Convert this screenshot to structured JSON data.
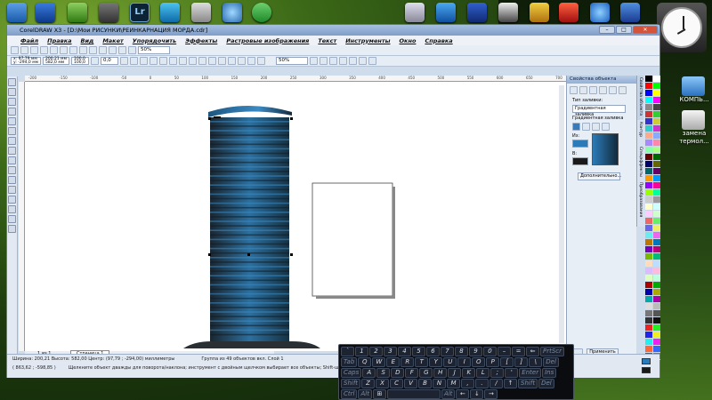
{
  "taskbar_icons": [
    "folder-icon",
    "tools-icon",
    "paint-icon",
    "lightroom-icon",
    "kaspersky-icon",
    "disk-icon",
    "globe-icon",
    "security-icon",
    "printer-icon",
    "sync-icon",
    "monitor-icon",
    "app-icon",
    "photo-icon",
    "camera-icon",
    "ie-icon",
    "bookmark-icon"
  ],
  "lightroom_label": "Lr",
  "desktop": {
    "icon1_label": "КОМПЬ...",
    "icon2_label": "замена термол..."
  },
  "window": {
    "title": "CorelDRAW X3 - [D:\\Мои РИСУНКИ\\РЕИНКАРНАЦИЯ МОРДА.cdr]",
    "controls": [
      "–",
      "□",
      "✕"
    ]
  },
  "menu": [
    "Файл",
    "Правка",
    "Вид",
    "Макет",
    "Упорядочить",
    "Эффекты",
    "Растровые изображения",
    "Текст",
    "Инструменты",
    "Окно",
    "Справка"
  ],
  "toolbar": {
    "zoom1": "50%",
    "zoom2": "50%",
    "x": "x: 97,79 мм",
    "y": "y: -294,0 мм",
    "w": "200,21 мм",
    "h": "582,0 мм",
    "sx": "100,0",
    "sy": "100,0",
    "angle": "0,0"
  },
  "ruler_ticks": [
    "-200",
    "-150",
    "-100",
    "-50",
    "0",
    "50",
    "100",
    "150",
    "200",
    "250",
    "300",
    "350",
    "400",
    "450",
    "500",
    "550",
    "600",
    "650",
    "700"
  ],
  "docker": {
    "title": "Свойства объекта",
    "fill_type_label": "Тип заливки:",
    "fill_type_value": "Градиентная заливка",
    "gradient_label": "Градиентная заливка",
    "from_label": "Из:",
    "to_label": "В:",
    "advanced_button": "Дополнительно...",
    "apply_button": "Применить",
    "vtabs": [
      "Свойства объекта",
      "Контур",
      "Спецэффекты",
      "Преобразования"
    ]
  },
  "pages": {
    "counter": "1 из 1",
    "tab": "Страница 1"
  },
  "status": {
    "line1_left": "Ширина: 200,21 Высота: 582,00 Центр: (97,79 ; -294,00) миллиметры",
    "line1_right": "Группа из 49 объектов вкл. Слой 1",
    "line2_coords": "( 863,62 ; -598,85 )",
    "line2_hint": "Щелкните объект дважды для поворота/наклона; инструмент с двойным щелчком выбирает все объекты; Shift-щелчок - выбор нескол..."
  },
  "keyboard": {
    "row1": [
      "`",
      "1",
      "2",
      "3",
      "4",
      "5",
      "6",
      "7",
      "8",
      "9",
      "0",
      "–",
      "=",
      "⇐",
      "PrtScr"
    ],
    "row2": [
      "Tab",
      "Q",
      "W",
      "E",
      "R",
      "T",
      "Y",
      "U",
      "I",
      "O",
      "P",
      "[",
      "]",
      "\\",
      "Del"
    ],
    "row3": [
      "Caps",
      "A",
      "S",
      "D",
      "F",
      "G",
      "H",
      "J",
      "K",
      "L",
      ";",
      "'",
      "Enter",
      "Ins"
    ],
    "row4": [
      "Shift",
      "Z",
      "X",
      "C",
      "V",
      "B",
      "N",
      "M",
      ",",
      ".",
      "/",
      "↑",
      "Shift",
      "Del"
    ],
    "row5": [
      "Ctrl",
      "Alt",
      "⊞",
      "",
      "Alt",
      "←",
      "↓",
      "→"
    ]
  },
  "colors": {
    "accent_blue": "#2a7bb8",
    "dark": "#1a1a1a",
    "window_frame": "#5b7aa3"
  }
}
